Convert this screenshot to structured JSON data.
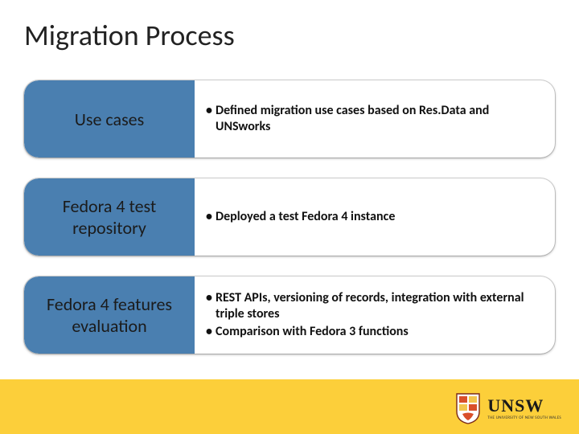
{
  "title": "Migration Process",
  "rows": [
    {
      "label": "Use cases",
      "bullets": [
        "Defined migration use cases based on Res.Data and UNSworks"
      ]
    },
    {
      "label": "Fedora 4 test repository",
      "bullets": [
        "Deployed a test Fedora 4 instance"
      ]
    },
    {
      "label": "Fedora 4 features evaluation",
      "bullets": [
        "REST APIs, versioning of records, integration with external triple stores",
        "Comparison with Fedora 3 functions"
      ]
    }
  ],
  "footer": {
    "org": "UNSW",
    "tagline": "THE UNIVERSITY OF NEW SOUTH WALES"
  },
  "colors": {
    "accent_blue": "#4a7fb0",
    "footer_yellow": "#fccf3a"
  }
}
